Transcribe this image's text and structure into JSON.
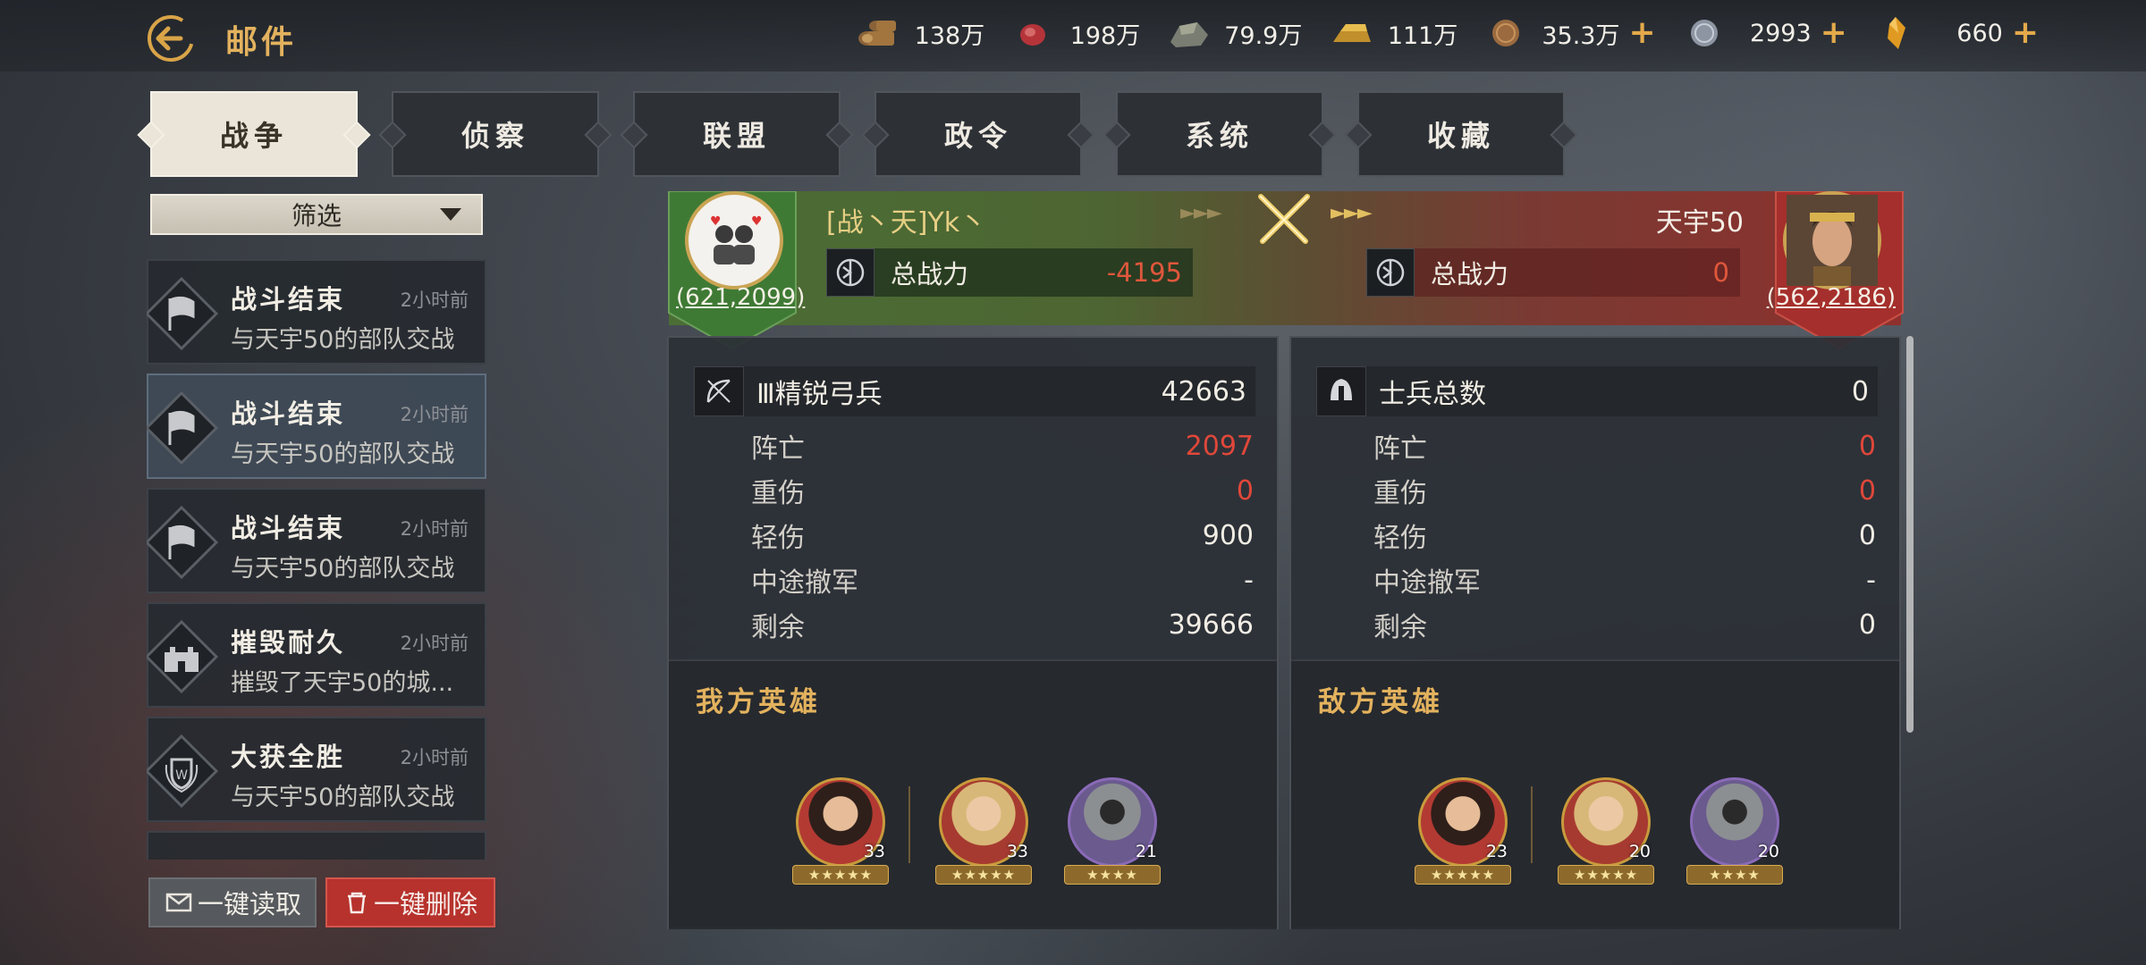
{
  "header": {
    "title": "邮件",
    "resources": [
      {
        "icon": "wood-icon",
        "value": "138万",
        "plus": false
      },
      {
        "icon": "meat-icon",
        "value": "198万",
        "plus": false
      },
      {
        "icon": "stone-icon",
        "value": "79.9万",
        "plus": false
      },
      {
        "icon": "gold-bar-icon",
        "value": "111万",
        "plus": false
      },
      {
        "icon": "copper-coin-icon",
        "value": "35.3万",
        "plus": true
      },
      {
        "icon": "silver-coin-icon",
        "value": "2993",
        "plus": true
      },
      {
        "icon": "crystal-icon",
        "value": "660",
        "plus": true
      }
    ]
  },
  "tabs": [
    {
      "label": "战争",
      "active": true
    },
    {
      "label": "侦察",
      "active": false
    },
    {
      "label": "联盟",
      "active": false
    },
    {
      "label": "政令",
      "active": false
    },
    {
      "label": "系统",
      "active": false
    },
    {
      "label": "收藏",
      "active": false
    }
  ],
  "filter": {
    "label": "筛选"
  },
  "mails": [
    {
      "title": "战斗结束",
      "time": "2小时前",
      "desc": "与天宇50的部队交战",
      "icon": "battle-flag-icon",
      "selected": false
    },
    {
      "title": "战斗结束",
      "time": "2小时前",
      "desc": "与天宇50的部队交战",
      "icon": "battle-flag-icon",
      "selected": true
    },
    {
      "title": "战斗结束",
      "time": "2小时前",
      "desc": "与天宇50的部队交战",
      "icon": "battle-flag-icon",
      "selected": false
    },
    {
      "title": "摧毁耐久",
      "time": "2小时前",
      "desc": "摧毁了天宇50的城...",
      "icon": "castle-icon",
      "selected": false
    },
    {
      "title": "大获全胜",
      "time": "2小时前",
      "desc": "与天宇50的部队交战",
      "icon": "victory-crest-icon",
      "selected": false
    }
  ],
  "actions": {
    "read_all": "一键读取",
    "delete_all": "一键删除"
  },
  "battle": {
    "left": {
      "name": "[战丶天]Yk丶",
      "coord": "(621,2099)",
      "power_label": "总战力",
      "power": "-4195"
    },
    "right": {
      "name": "天宇50",
      "coord": "(562,2186)",
      "power_label": "总战力",
      "power": "0"
    }
  },
  "left_panel": {
    "unit_name": "Ⅲ精锐弓兵",
    "unit_count": "42663",
    "stats": [
      {
        "label": "阵亡",
        "value": "2097",
        "red": true
      },
      {
        "label": "重伤",
        "value": "0",
        "red": true
      },
      {
        "label": "轻伤",
        "value": "900",
        "red": false
      },
      {
        "label": "中途撤军",
        "value": "-",
        "red": false
      },
      {
        "label": "剩余",
        "value": "39666",
        "red": false
      }
    ],
    "heroes_title": "我方英雄",
    "heroes": [
      {
        "level": "33",
        "stars": "★★★★★",
        "frame": "gold"
      },
      {
        "level": "33",
        "stars": "★★★★★",
        "frame": "gold"
      },
      {
        "level": "21",
        "stars": "★★★★",
        "frame": "purple"
      }
    ]
  },
  "right_panel": {
    "unit_name": "士兵总数",
    "unit_count": "0",
    "stats": [
      {
        "label": "阵亡",
        "value": "0",
        "red": true
      },
      {
        "label": "重伤",
        "value": "0",
        "red": true
      },
      {
        "label": "轻伤",
        "value": "0",
        "red": false
      },
      {
        "label": "中途撤军",
        "value": "-",
        "red": false
      },
      {
        "label": "剩余",
        "value": "0",
        "red": false
      }
    ],
    "heroes_title": "敌方英雄",
    "heroes": [
      {
        "level": "23",
        "stars": "★★★★★",
        "frame": "gold"
      },
      {
        "level": "20",
        "stars": "★★★★★",
        "frame": "gold"
      },
      {
        "level": "20",
        "stars": "★★★★",
        "frame": "purple"
      }
    ]
  },
  "colors": {
    "accent": "#e3b25e",
    "danger": "#e0473a",
    "ally": "#4b6e35",
    "enemy": "#8e302d"
  }
}
